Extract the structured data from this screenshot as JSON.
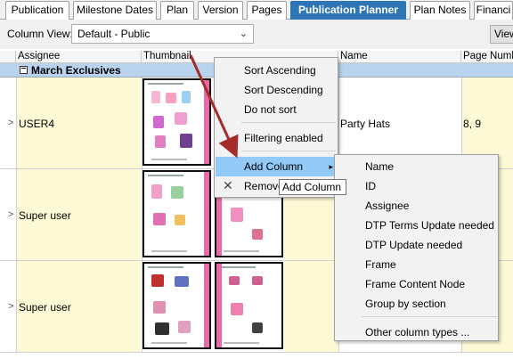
{
  "tabs": [
    {
      "label": "Publication",
      "active": false
    },
    {
      "label": "Milestone Dates",
      "active": false
    },
    {
      "label": "Plan",
      "active": false
    },
    {
      "label": "Version",
      "active": false
    },
    {
      "label": "Pages",
      "active": false
    },
    {
      "label": "Publication Planner",
      "active": true
    },
    {
      "label": "Plan Notes",
      "active": false
    },
    {
      "label": "Financi",
      "active": false
    }
  ],
  "toolbar": {
    "column_view_label": "Column View:",
    "column_view_value": "Default - Public",
    "view_button": "View"
  },
  "grid": {
    "columns": [
      "Assignee",
      "Thumbnail",
      "Name",
      "Page Numbe"
    ],
    "group": {
      "toggle": "−",
      "label": "March Exclusives"
    },
    "rows": [
      {
        "expander": ">",
        "assignee": "USER4",
        "name": "Party Hats",
        "pages": "8, 9"
      },
      {
        "expander": ">",
        "assignee": "Super user",
        "name": "",
        "pages": ""
      },
      {
        "expander": ">",
        "assignee": "Super user",
        "name": "",
        "pages": ""
      }
    ]
  },
  "context_menu": {
    "items": [
      {
        "label": "Sort Ascending"
      },
      {
        "label": "Sort Descending"
      },
      {
        "label": "Do not sort"
      },
      {
        "label": "Filtering enabled"
      },
      {
        "label": "Add Column",
        "arrow": "›"
      },
      {
        "label": "Remove"
      }
    ],
    "tooltip": "Add Column"
  },
  "submenu": {
    "items": [
      "Name",
      "ID",
      "Assignee",
      "DTP Terms Update needed",
      "DTP Update needed",
      "Frame",
      "Frame Content Node",
      "Group by section"
    ],
    "other": "Other column types ..."
  },
  "colors": {
    "accent": "#2e75b6",
    "highlight": "#91c9f7",
    "group": "#b9d2ee",
    "annotation": "#a52a2a",
    "pink": "#e86aa8"
  }
}
